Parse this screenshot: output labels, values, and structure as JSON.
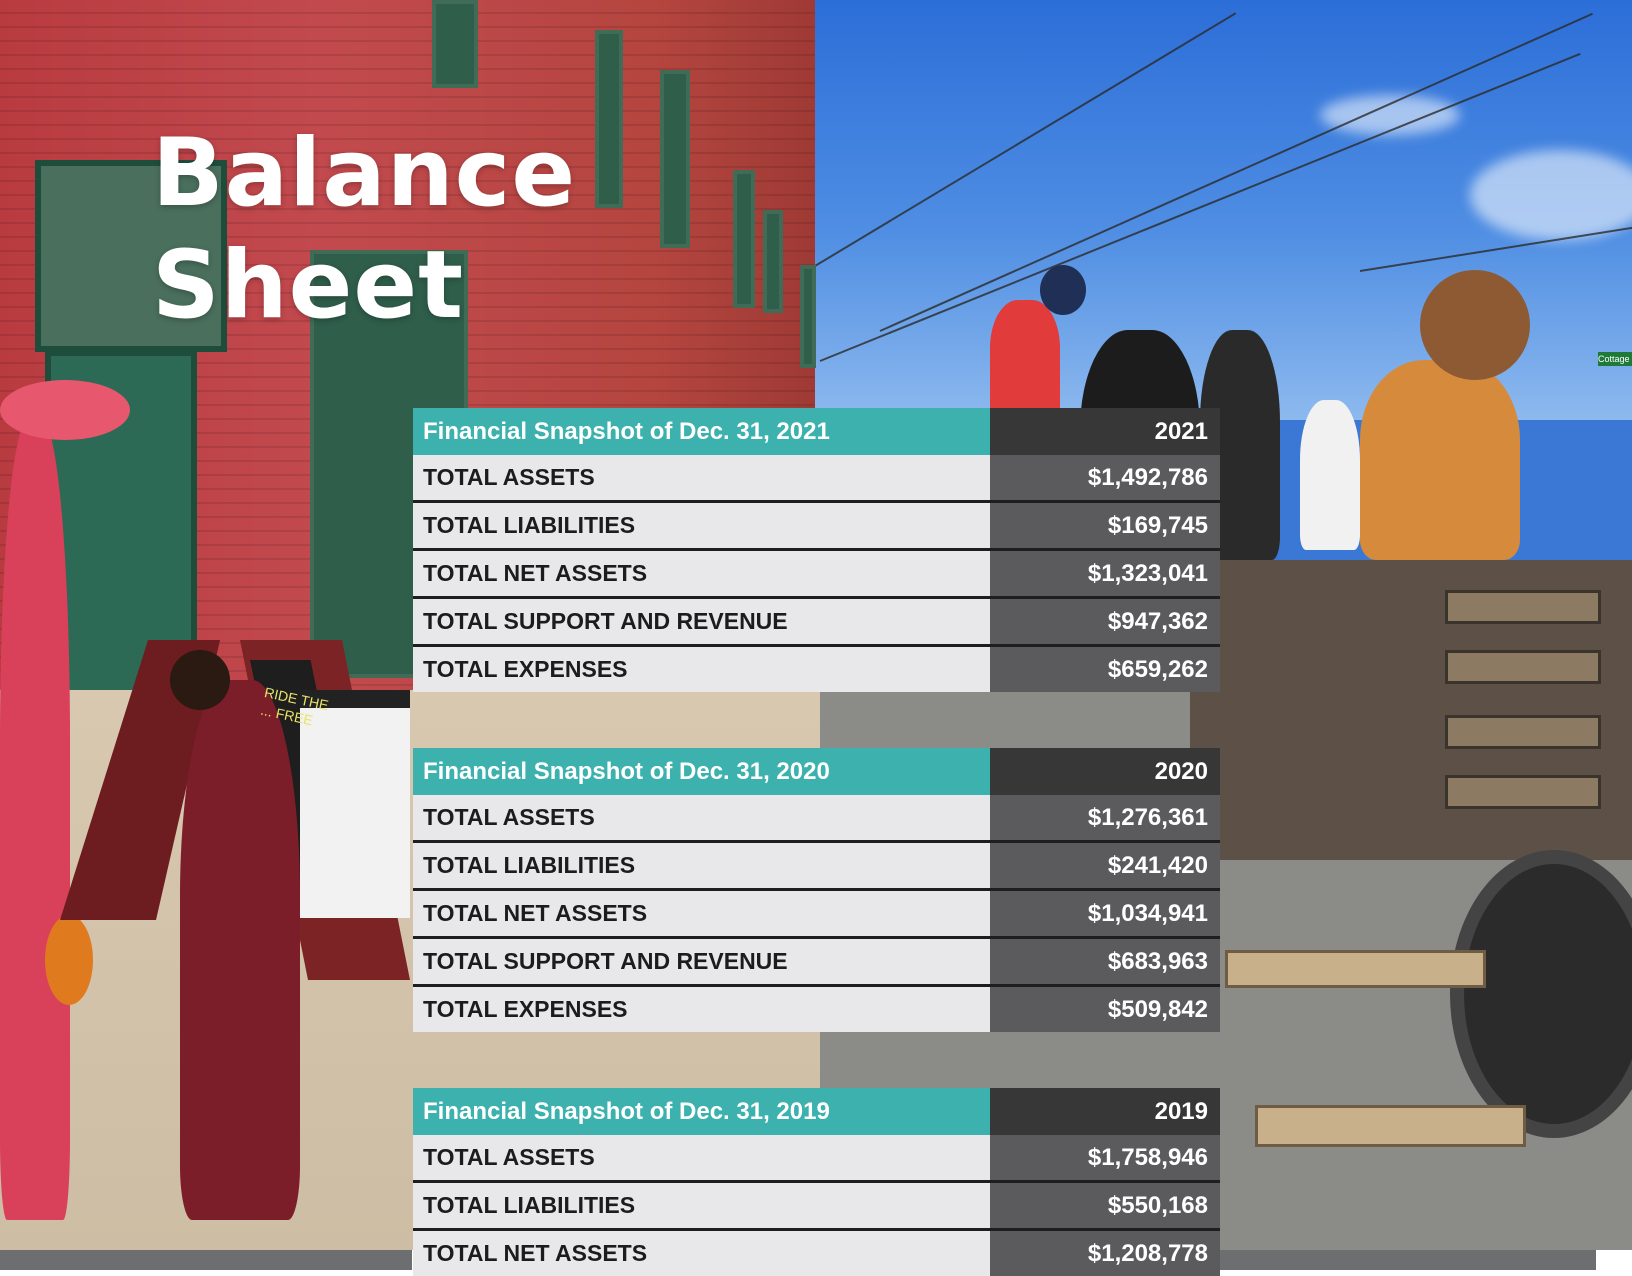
{
  "page": {
    "title_line1": "Balance",
    "title_line2": "Sheet"
  },
  "snapshots": [
    {
      "heading": "Financial Snapshot of Dec. 31, 2021",
      "year": "2021",
      "rows": [
        {
          "label": "TOTAL ASSETS",
          "value": "$1,492,786"
        },
        {
          "label": "TOTAL LIABILITIES",
          "value": "$169,745"
        },
        {
          "label": "TOTAL NET ASSETS",
          "value": "$1,323,041"
        },
        {
          "label": "TOTAL SUPPORT AND REVENUE",
          "value": "$947,362"
        },
        {
          "label": "TOTAL EXPENSES",
          "value": "$659,262"
        }
      ]
    },
    {
      "heading": "Financial Snapshot of Dec. 31, 2020",
      "year": "2020",
      "rows": [
        {
          "label": "TOTAL ASSETS",
          "value": "$1,276,361"
        },
        {
          "label": "TOTAL LIABILITIES",
          "value": "$241,420"
        },
        {
          "label": "TOTAL NET ASSETS",
          "value": "$1,034,941"
        },
        {
          "label": "TOTAL SUPPORT AND REVENUE",
          "value": "$683,963"
        },
        {
          "label": "TOTAL EXPENSES",
          "value": "$509,842"
        }
      ]
    },
    {
      "heading": "Financial Snapshot of Dec. 31, 2019",
      "year": "2019",
      "rows": [
        {
          "label": "TOTAL ASSETS",
          "value": "$1,758,946"
        },
        {
          "label": "TOTAL LIABILITIES",
          "value": "$550,168"
        },
        {
          "label": "TOTAL NET ASSETS",
          "value": "$1,208,778"
        }
      ]
    }
  ],
  "colors": {
    "heading_teal": "#3db1ad",
    "year_cell": "#373737",
    "label_cell": "#e8e8ea",
    "value_cell": "#5b5b5d"
  },
  "background_photo": {
    "signs": [
      "RIDE THE ... FREE",
      "Cottage"
    ]
  }
}
